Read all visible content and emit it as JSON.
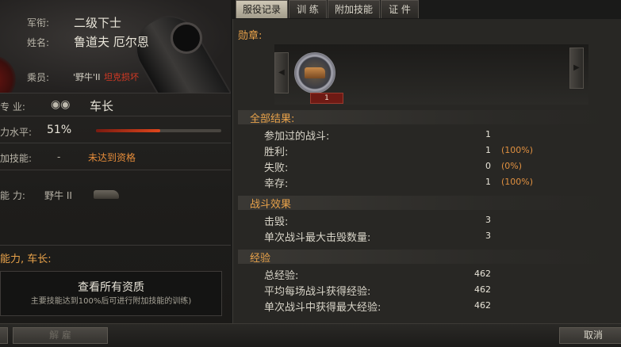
{
  "tabs": [
    {
      "label": "服役记录",
      "active": true
    },
    {
      "label": "训 练",
      "active": false
    },
    {
      "label": "附加技能",
      "active": false
    },
    {
      "label": "证 件",
      "active": false
    }
  ],
  "crew": {
    "rank_label": "军衔:",
    "rank_value": "二级下士",
    "name_label": "姓名:",
    "name_value": "鲁道夫 厄尔恩",
    "member_label": "乘员:",
    "member_vehicle": "'野牛'II",
    "member_status": "坦克损坏",
    "specialty_label": "专 业:",
    "specialty_value": "车长",
    "skill_label": "力水平:",
    "skill_value": "51%",
    "skill_fraction": 0.51,
    "extra_label": "加技能:",
    "extra_dash": "-",
    "extra_value": "未达到资格",
    "ability_label": "能 力:",
    "ability_vehicle": "野牛 II",
    "ability_heading": "能力, 车长:",
    "view_all_title": "查看所有资质",
    "view_all_sub": "主要技能达到100%后可进行附加技能的训练)"
  },
  "medals": {
    "label": "勋章:",
    "count": "1"
  },
  "results": {
    "title": "全部结果:",
    "rows": [
      {
        "label": "参加过的战斗:",
        "value": "1",
        "pct": ""
      },
      {
        "label": "胜利:",
        "value": "1",
        "pct": "(100%)"
      },
      {
        "label": "失败:",
        "value": "0",
        "pct": "(0%)"
      },
      {
        "label": "幸存:",
        "value": "1",
        "pct": "(100%)"
      }
    ]
  },
  "battle": {
    "title": "战斗效果",
    "rows": [
      {
        "label": "击毁:",
        "value": "3"
      },
      {
        "label": "单次战斗最大击毁数量:",
        "value": "3"
      }
    ]
  },
  "exp": {
    "title": "经验",
    "rows": [
      {
        "label": "总经验:",
        "value": "462"
      },
      {
        "label": "平均每场战斗获得经验:",
        "value": "462"
      },
      {
        "label": "单次战斗中获得最大经验:",
        "value": "462"
      }
    ]
  },
  "footer": {
    "dismiss": "解 雇",
    "cancel": "取消"
  },
  "colors": {
    "accent": "#e8a24a",
    "warning": "#d63a24",
    "panel": "#282724"
  }
}
